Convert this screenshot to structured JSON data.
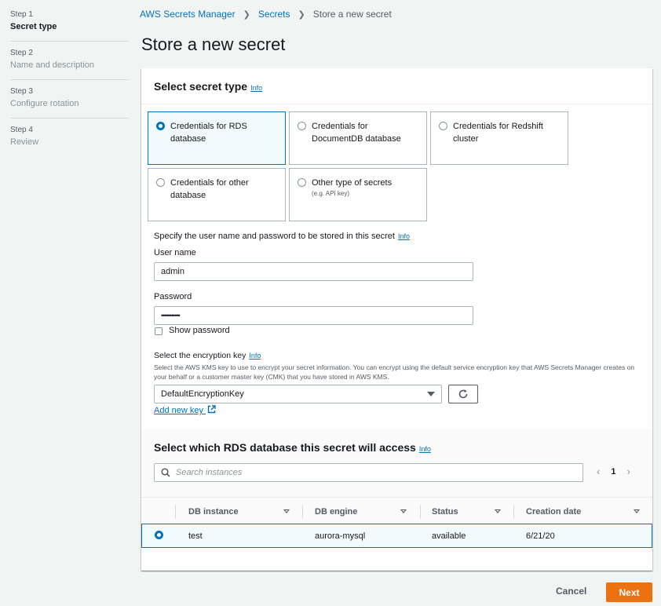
{
  "steps": [
    {
      "number": "Step 1",
      "title": "Secret type"
    },
    {
      "number": "Step 2",
      "title": "Name and description"
    },
    {
      "number": "Step 3",
      "title": "Configure rotation"
    },
    {
      "number": "Step 4",
      "title": "Review"
    }
  ],
  "breadcrumb": {
    "root": "AWS Secrets Manager",
    "secrets": "Secrets",
    "current": "Store a new secret"
  },
  "page_title": "Store a new secret",
  "secret_type": {
    "heading": "Select secret type",
    "info": "Info",
    "options": [
      {
        "label": "Credentials for RDS database",
        "selected": true
      },
      {
        "label": "Credentials for DocumentDB database",
        "selected": false
      },
      {
        "label": "Credentials for Redshift cluster",
        "selected": false
      },
      {
        "label": "Credentials for other database",
        "selected": false
      },
      {
        "label": "Other type of secrets",
        "sub": "(e.g. API key)",
        "selected": false
      }
    ]
  },
  "credentials": {
    "intro": "Specify the user name and password to be stored in this secret",
    "info": "Info",
    "username_label": "User name",
    "username_value": "admin",
    "password_label": "Password",
    "password_value": "•••••••••••",
    "show_password": "Show password"
  },
  "encryption": {
    "label": "Select the encryption key",
    "info": "Info",
    "description": "Select the AWS KMS key to use to encrypt your secret information. You can encrypt using the default service encryption key that AWS Secrets Manager creates on your behalf or a customer master key (CMK) that you have stored in AWS KMS.",
    "selected_key": "DefaultEncryptionKey",
    "add_new_key": "Add new key"
  },
  "database": {
    "heading": "Select which RDS database this secret will access",
    "info": "Info",
    "search_placeholder": "Search instances",
    "page": "1",
    "columns": [
      "DB instance",
      "DB engine",
      "Status",
      "Creation date"
    ],
    "rows": [
      {
        "instance": "test",
        "engine": "aurora-mysql",
        "status": "available",
        "created": "6/21/20",
        "selected": true
      }
    ]
  },
  "footer": {
    "cancel": "Cancel",
    "next": "Next"
  },
  "colors": {
    "accent": "#0073bb",
    "primary_button": "#ec7211"
  }
}
